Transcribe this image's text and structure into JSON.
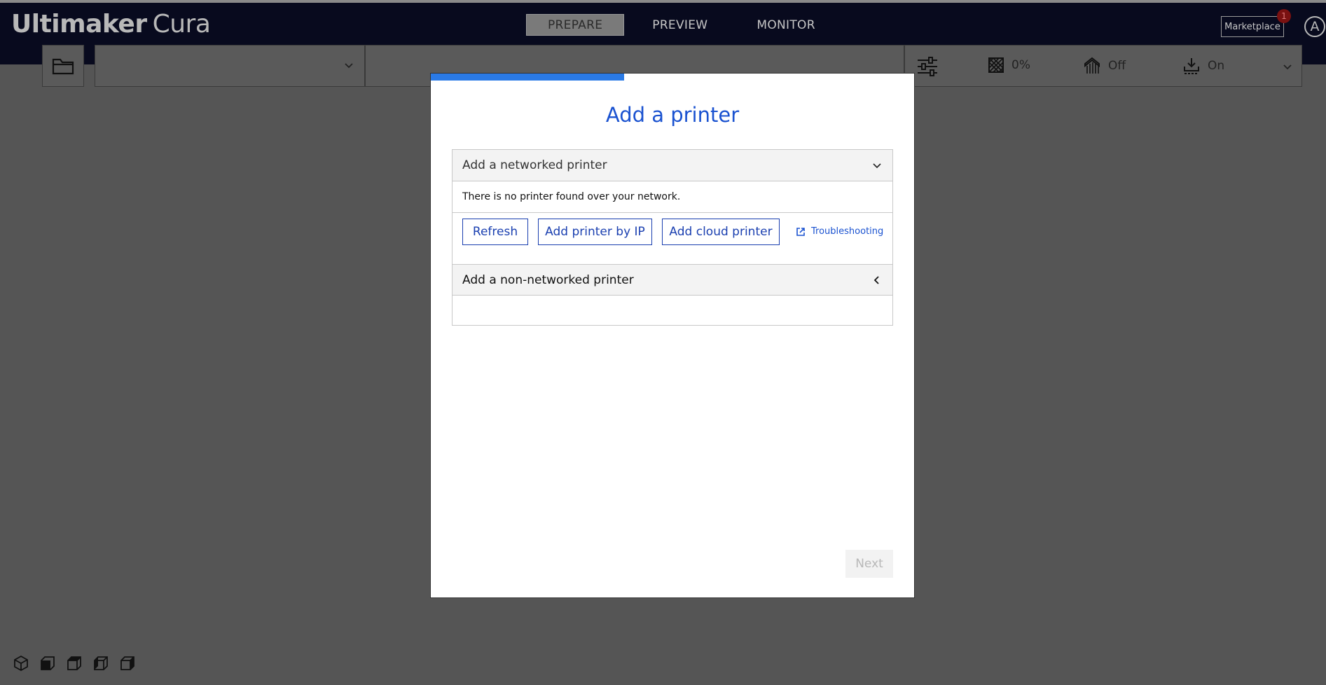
{
  "app": {
    "brand_bold": "Ultimaker",
    "brand_light": "Cura",
    "stages": [
      "PREPARE",
      "PREVIEW",
      "MONITOR"
    ],
    "active_stage": "PREPARE",
    "marketplace_label": "Marketplace",
    "marketplace_badge": "1",
    "account_initial": "A"
  },
  "toolbar": {
    "printer_selected": "",
    "infill_value": "0%",
    "support_value": "Off",
    "adhesion_value": "On"
  },
  "dialog": {
    "title": "Add a printer",
    "progress_fraction": 0.4,
    "networked": {
      "header": "Add a networked printer",
      "message": "There is no printer found over your network.",
      "refresh_label": "Refresh",
      "add_by_ip_label": "Add printer by IP",
      "add_cloud_label": "Add cloud printer",
      "troubleshooting_label": "Troubleshooting"
    },
    "non_networked": {
      "header": "Add a non-networked printer"
    },
    "next_label": "Next"
  },
  "icons": {
    "views": [
      "3d-view-icon",
      "front-view-icon",
      "top-view-icon",
      "left-view-icon",
      "right-view-icon"
    ]
  },
  "colors": {
    "header_bg": "#080a1e",
    "accent_blue": "#1a52d0",
    "progress_blue": "#2a7ae6",
    "overlay_gray": "#555555"
  }
}
